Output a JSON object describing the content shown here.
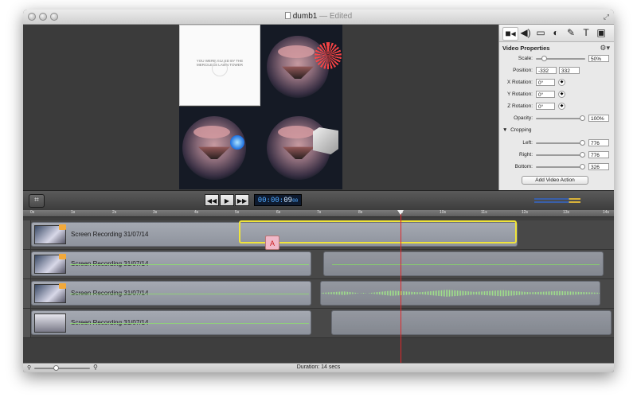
{
  "window": {
    "title": "dumb1",
    "title_suffix": "— Edited"
  },
  "canvas": {
    "overlay_text": "YOU WERE KILLED BY THE MERCILESS LAWN TOWER"
  },
  "inspector": {
    "tabs": [
      {
        "name": "video",
        "icon": "■◂"
      },
      {
        "name": "audio",
        "icon": "◀)"
      },
      {
        "name": "screen",
        "icon": "▭"
      },
      {
        "name": "cursor",
        "icon": "◐"
      },
      {
        "name": "annotations",
        "icon": "✎"
      },
      {
        "name": "text",
        "icon": "T"
      },
      {
        "name": "image",
        "icon": "▣"
      }
    ],
    "heading": "Video Properties",
    "scale": {
      "label": "Scale:",
      "value": "50%",
      "level": 0.12
    },
    "position": {
      "label": "Position:",
      "x": "-332",
      "y": "332"
    },
    "x_rotation": {
      "label": "X Rotation:",
      "value": "0°"
    },
    "y_rotation": {
      "label": "Y Rotation:",
      "value": "0°"
    },
    "z_rotation": {
      "label": "Z Rotation:",
      "value": "0°"
    },
    "opacity": {
      "label": "Opacity:",
      "value": "100%",
      "level": 1.0
    },
    "cropping": {
      "label": "Cropping"
    },
    "left": {
      "label": "Left:",
      "value": "776",
      "level": 1.0
    },
    "right": {
      "label": "Right:",
      "value": "776",
      "level": 1.0
    },
    "bottom": {
      "label": "Bottom:",
      "value": "326",
      "level": 1.0
    },
    "add_action": "Add Video Action"
  },
  "toolbar": {
    "rewind": "◀◀",
    "play": "▶",
    "forward": "▶▶",
    "timecode_dim": "00:00:",
    "timecode_bright": "09",
    "timecode_frames": "00"
  },
  "ruler": {
    "ticks": [
      "0s",
      "1s",
      "2s",
      "3s",
      "4s",
      "5s",
      "6s",
      "7s",
      "8s",
      "9s",
      "10s",
      "11s",
      "12s",
      "13s",
      "14s"
    ]
  },
  "tracks": [
    {
      "title": "Screen Recording 31/07/14"
    },
    {
      "title": "Screen Recording 31/07/14"
    },
    {
      "title": "Screen Recording 31/07/14"
    },
    {
      "title": "Screen Recording 31/07/14"
    }
  ],
  "status": {
    "duration": "Duration: 14 secs"
  },
  "colors": {
    "accent_selection": "#f0e43a",
    "playhead": "#e0282a",
    "timecode": "#4fa8ff"
  }
}
